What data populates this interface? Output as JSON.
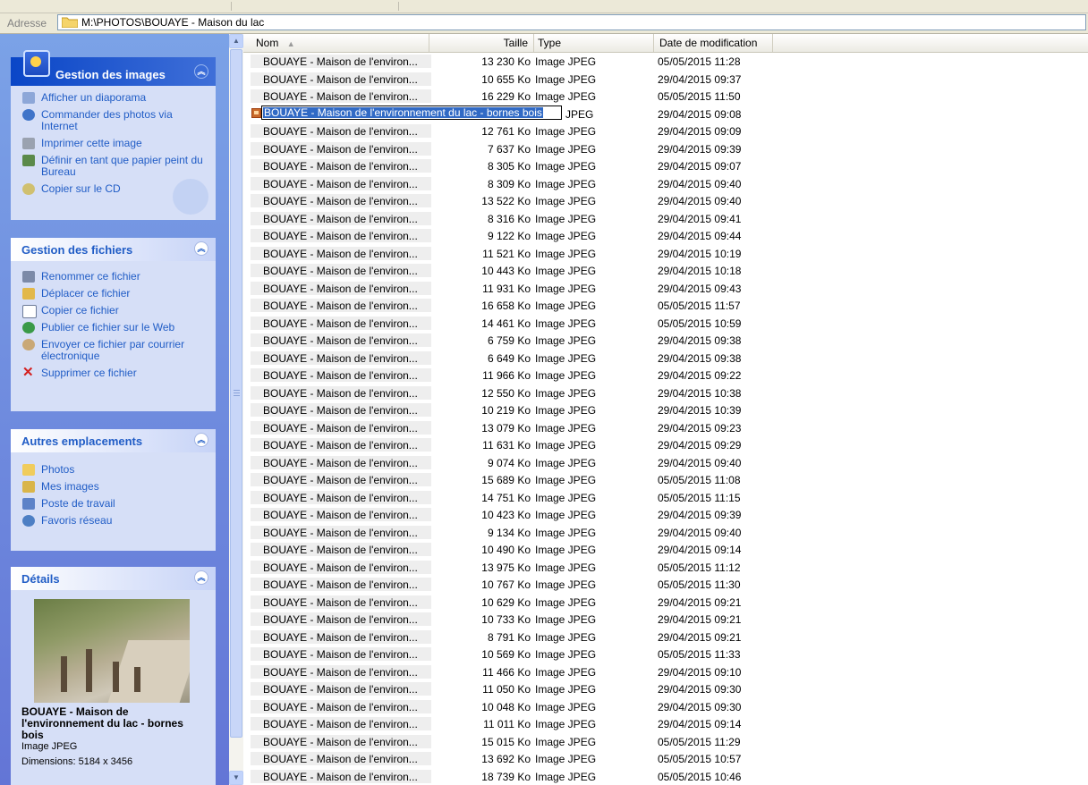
{
  "address": {
    "label": "Adresse",
    "path": "M:\\PHOTOS\\BOUAYE  - Maison du lac"
  },
  "panels": {
    "images": {
      "title": "Gestion des images",
      "items": [
        {
          "label": "Afficher un diaporama",
          "icon": "slideshow-icon"
        },
        {
          "label": "Commander des photos via Internet",
          "icon": "order-photos-icon"
        },
        {
          "label": "Imprimer cette image",
          "icon": "printer-icon"
        },
        {
          "label": "Définir en tant que papier peint du Bureau",
          "icon": "wallpaper-icon"
        },
        {
          "label": "Copier sur le CD",
          "icon": "cd-icon"
        }
      ]
    },
    "files": {
      "title": "Gestion des fichiers",
      "items": [
        {
          "label": "Renommer ce fichier",
          "icon": "rename-icon"
        },
        {
          "label": "Déplacer ce fichier",
          "icon": "move-icon"
        },
        {
          "label": "Copier ce fichier",
          "icon": "copy-icon"
        },
        {
          "label": "Publier ce fichier sur le Web",
          "icon": "globe-icon"
        },
        {
          "label": "Envoyer ce fichier par courrier électronique",
          "icon": "mail-icon"
        },
        {
          "label": "Supprimer ce fichier",
          "icon": "delete-icon"
        }
      ]
    },
    "places": {
      "title": "Autres emplacements",
      "items": [
        {
          "label": "Photos",
          "icon": "folder-icon"
        },
        {
          "label": "Mes images",
          "icon": "my-pictures-icon"
        },
        {
          "label": "Poste de travail",
          "icon": "computer-icon"
        },
        {
          "label": "Favoris réseau",
          "icon": "network-icon"
        }
      ]
    },
    "details": {
      "title": "Détails",
      "name": "BOUAYE - Maison de l'environnement du lac - bornes bois",
      "type": "Image JPEG",
      "dimensions": "Dimensions: 5184 x 3456"
    }
  },
  "columns": {
    "name": "Nom",
    "size": "Taille",
    "type": "Type",
    "date": "Date de modification"
  },
  "rename_value": "BOUAYE - Maison de l'environnement du lac - bornes bois",
  "files": [
    {
      "name": "BOUAYE - Maison de l'environ...",
      "size": "13 230 Ko",
      "type": "Image JPEG",
      "date": "05/05/2015 11:28"
    },
    {
      "name": "BOUAYE - Maison de l'environ...",
      "size": "10 655 Ko",
      "type": "Image JPEG",
      "date": "29/04/2015 09:37"
    },
    {
      "name": "BOUAYE - Maison de l'environ...",
      "size": "16 229 Ko",
      "type": "Image JPEG",
      "date": "05/05/2015 11:50"
    },
    {
      "name": "",
      "size": "",
      "type": "JPEG",
      "date": "29/04/2015 09:08",
      "editing": true
    },
    {
      "name": "BOUAYE - Maison de l'environ...",
      "size": "12 761 Ko",
      "type": "Image JPEG",
      "date": "29/04/2015 09:09"
    },
    {
      "name": "BOUAYE - Maison de l'environ...",
      "size": "7 637 Ko",
      "type": "Image JPEG",
      "date": "29/04/2015 09:39"
    },
    {
      "name": "BOUAYE - Maison de l'environ...",
      "size": "8 305 Ko",
      "type": "Image JPEG",
      "date": "29/04/2015 09:07"
    },
    {
      "name": "BOUAYE - Maison de l'environ...",
      "size": "8 309 Ko",
      "type": "Image JPEG",
      "date": "29/04/2015 09:40"
    },
    {
      "name": "BOUAYE - Maison de l'environ...",
      "size": "13 522 Ko",
      "type": "Image JPEG",
      "date": "29/04/2015 09:40"
    },
    {
      "name": "BOUAYE - Maison de l'environ...",
      "size": "8 316 Ko",
      "type": "Image JPEG",
      "date": "29/04/2015 09:41"
    },
    {
      "name": "BOUAYE - Maison de l'environ...",
      "size": "9 122 Ko",
      "type": "Image JPEG",
      "date": "29/04/2015 09:44"
    },
    {
      "name": "BOUAYE - Maison de l'environ...",
      "size": "11 521 Ko",
      "type": "Image JPEG",
      "date": "29/04/2015 10:19"
    },
    {
      "name": "BOUAYE - Maison de l'environ...",
      "size": "10 443 Ko",
      "type": "Image JPEG",
      "date": "29/04/2015 10:18"
    },
    {
      "name": "BOUAYE - Maison de l'environ...",
      "size": "11 931 Ko",
      "type": "Image JPEG",
      "date": "29/04/2015 09:43"
    },
    {
      "name": "BOUAYE - Maison de l'environ...",
      "size": "16 658 Ko",
      "type": "Image JPEG",
      "date": "05/05/2015 11:57"
    },
    {
      "name": "BOUAYE - Maison de l'environ...",
      "size": "14 461 Ko",
      "type": "Image JPEG",
      "date": "05/05/2015 10:59"
    },
    {
      "name": "BOUAYE - Maison de l'environ...",
      "size": "6 759 Ko",
      "type": "Image JPEG",
      "date": "29/04/2015 09:38"
    },
    {
      "name": "BOUAYE - Maison de l'environ...",
      "size": "6 649 Ko",
      "type": "Image JPEG",
      "date": "29/04/2015 09:38"
    },
    {
      "name": "BOUAYE - Maison de l'environ...",
      "size": "11 966 Ko",
      "type": "Image JPEG",
      "date": "29/04/2015 09:22"
    },
    {
      "name": "BOUAYE - Maison de l'environ...",
      "size": "12 550 Ko",
      "type": "Image JPEG",
      "date": "29/04/2015 10:38"
    },
    {
      "name": "BOUAYE - Maison de l'environ...",
      "size": "10 219 Ko",
      "type": "Image JPEG",
      "date": "29/04/2015 10:39"
    },
    {
      "name": "BOUAYE - Maison de l'environ...",
      "size": "13 079 Ko",
      "type": "Image JPEG",
      "date": "29/04/2015 09:23"
    },
    {
      "name": "BOUAYE - Maison de l'environ...",
      "size": "11 631 Ko",
      "type": "Image JPEG",
      "date": "29/04/2015 09:29"
    },
    {
      "name": "BOUAYE - Maison de l'environ...",
      "size": "9 074 Ko",
      "type": "Image JPEG",
      "date": "29/04/2015 09:40"
    },
    {
      "name": "BOUAYE - Maison de l'environ...",
      "size": "15 689 Ko",
      "type": "Image JPEG",
      "date": "05/05/2015 11:08"
    },
    {
      "name": "BOUAYE - Maison de l'environ...",
      "size": "14 751 Ko",
      "type": "Image JPEG",
      "date": "05/05/2015 11:15"
    },
    {
      "name": "BOUAYE - Maison de l'environ...",
      "size": "10 423 Ko",
      "type": "Image JPEG",
      "date": "29/04/2015 09:39"
    },
    {
      "name": "BOUAYE - Maison de l'environ...",
      "size": "9 134 Ko",
      "type": "Image JPEG",
      "date": "29/04/2015 09:40"
    },
    {
      "name": "BOUAYE - Maison de l'environ...",
      "size": "10 490 Ko",
      "type": "Image JPEG",
      "date": "29/04/2015 09:14"
    },
    {
      "name": "BOUAYE - Maison de l'environ...",
      "size": "13 975 Ko",
      "type": "Image JPEG",
      "date": "05/05/2015 11:12"
    },
    {
      "name": "BOUAYE - Maison de l'environ...",
      "size": "10 767 Ko",
      "type": "Image JPEG",
      "date": "05/05/2015 11:30"
    },
    {
      "name": "BOUAYE - Maison de l'environ...",
      "size": "10 629 Ko",
      "type": "Image JPEG",
      "date": "29/04/2015 09:21"
    },
    {
      "name": "BOUAYE - Maison de l'environ...",
      "size": "10 733 Ko",
      "type": "Image JPEG",
      "date": "29/04/2015 09:21"
    },
    {
      "name": "BOUAYE - Maison de l'environ...",
      "size": "8 791 Ko",
      "type": "Image JPEG",
      "date": "29/04/2015 09:21"
    },
    {
      "name": "BOUAYE - Maison de l'environ...",
      "size": "10 569 Ko",
      "type": "Image JPEG",
      "date": "05/05/2015 11:33"
    },
    {
      "name": "BOUAYE - Maison de l'environ...",
      "size": "11 466 Ko",
      "type": "Image JPEG",
      "date": "29/04/2015 09:10"
    },
    {
      "name": "BOUAYE - Maison de l'environ...",
      "size": "11 050 Ko",
      "type": "Image JPEG",
      "date": "29/04/2015 09:30"
    },
    {
      "name": "BOUAYE - Maison de l'environ...",
      "size": "10 048 Ko",
      "type": "Image JPEG",
      "date": "29/04/2015 09:30"
    },
    {
      "name": "BOUAYE - Maison de l'environ...",
      "size": "11 011 Ko",
      "type": "Image JPEG",
      "date": "29/04/2015 09:14"
    },
    {
      "name": "BOUAYE - Maison de l'environ...",
      "size": "15 015 Ko",
      "type": "Image JPEG",
      "date": "05/05/2015 11:29"
    },
    {
      "name": "BOUAYE - Maison de l'environ...",
      "size": "13 692 Ko",
      "type": "Image JPEG",
      "date": "05/05/2015 10:57"
    },
    {
      "name": "BOUAYE - Maison de l'environ...",
      "size": "18 739 Ko",
      "type": "Image JPEG",
      "date": "05/05/2015 10:46"
    }
  ],
  "colors": {
    "panel_gradient_top": "#7ba2e7",
    "task_link": "#215dc6",
    "selection": "#316ac5"
  }
}
